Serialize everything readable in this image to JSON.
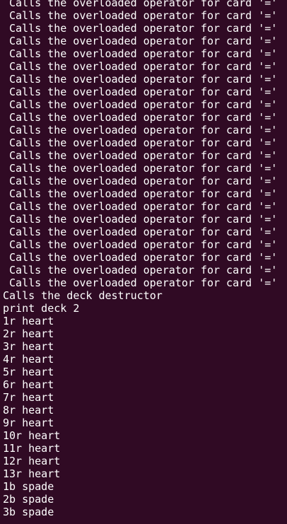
{
  "terminal": {
    "background": "#300a24",
    "foreground": "#ffffff",
    "lines": [
      {
        "text": "Calls the overloaded operator for card '='",
        "indent": true
      },
      {
        "text": "Calls the overloaded operator for card '='",
        "indent": true
      },
      {
        "text": "Calls the overloaded operator for card '='",
        "indent": true
      },
      {
        "text": "Calls the overloaded operator for card '='",
        "indent": true
      },
      {
        "text": "Calls the overloaded operator for card '='",
        "indent": true
      },
      {
        "text": "Calls the overloaded operator for card '='",
        "indent": true
      },
      {
        "text": "Calls the overloaded operator for card '='",
        "indent": true
      },
      {
        "text": "Calls the overloaded operator for card '='",
        "indent": true
      },
      {
        "text": "Calls the overloaded operator for card '='",
        "indent": true
      },
      {
        "text": "Calls the overloaded operator for card '='",
        "indent": true
      },
      {
        "text": "Calls the overloaded operator for card '='",
        "indent": true
      },
      {
        "text": "Calls the overloaded operator for card '='",
        "indent": true
      },
      {
        "text": "Calls the overloaded operator for card '='",
        "indent": true
      },
      {
        "text": "Calls the overloaded operator for card '='",
        "indent": true
      },
      {
        "text": "Calls the overloaded operator for card '='",
        "indent": true
      },
      {
        "text": "Calls the overloaded operator for card '='",
        "indent": true
      },
      {
        "text": "Calls the overloaded operator for card '='",
        "indent": true
      },
      {
        "text": "Calls the overloaded operator for card '='",
        "indent": true
      },
      {
        "text": "Calls the overloaded operator for card '='",
        "indent": true
      },
      {
        "text": "Calls the overloaded operator for card '='",
        "indent": true
      },
      {
        "text": "Calls the overloaded operator for card '='",
        "indent": true
      },
      {
        "text": "Calls the overloaded operator for card '='",
        "indent": true
      },
      {
        "text": "Calls the overloaded operator for card '='",
        "indent": true
      },
      {
        "text": "Calls the deck destructor",
        "indent": false
      },
      {
        "text": "print deck 2",
        "indent": false
      },
      {
        "text": "1r heart",
        "indent": false
      },
      {
        "text": "2r heart",
        "indent": false
      },
      {
        "text": "3r heart",
        "indent": false
      },
      {
        "text": "4r heart",
        "indent": false
      },
      {
        "text": "5r heart",
        "indent": false
      },
      {
        "text": "6r heart",
        "indent": false
      },
      {
        "text": "7r heart",
        "indent": false
      },
      {
        "text": "8r heart",
        "indent": false
      },
      {
        "text": "9r heart",
        "indent": false
      },
      {
        "text": "10r heart",
        "indent": false
      },
      {
        "text": "11r heart",
        "indent": false
      },
      {
        "text": "12r heart",
        "indent": false
      },
      {
        "text": "13r heart",
        "indent": false
      },
      {
        "text": "1b spade",
        "indent": false
      },
      {
        "text": "2b spade",
        "indent": false
      },
      {
        "text": "3b spade",
        "indent": false
      }
    ]
  }
}
